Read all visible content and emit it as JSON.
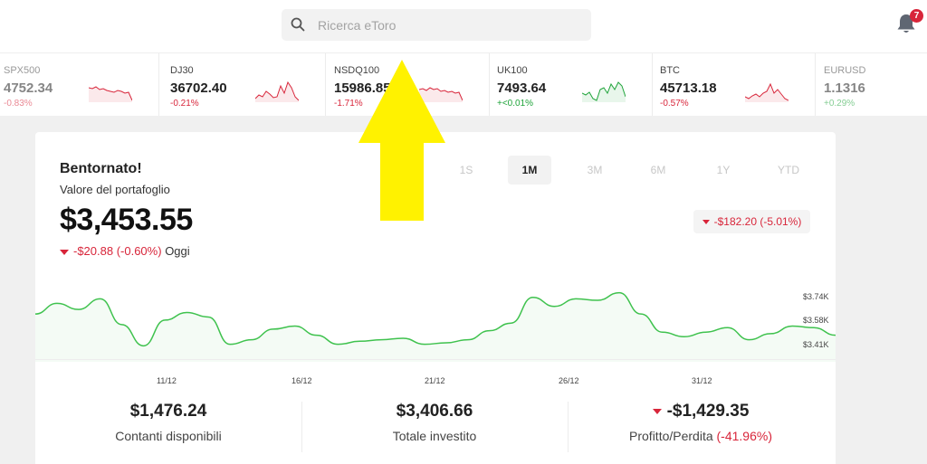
{
  "search": {
    "placeholder": "Ricerca eToro"
  },
  "notifications": {
    "count": "7"
  },
  "ticker": [
    {
      "symbol": "SPX500",
      "price": "4752.34",
      "change": "-0.83%",
      "dir": "neg",
      "spark": [
        8,
        9,
        7,
        10,
        9,
        11,
        12,
        13,
        11,
        12,
        14,
        13,
        22
      ]
    },
    {
      "symbol": "DJ30",
      "price": "36702.40",
      "change": "-0.21%",
      "dir": "neg",
      "spark": [
        20,
        16,
        18,
        12,
        15,
        19,
        18,
        6,
        14,
        2,
        8,
        18,
        22
      ]
    },
    {
      "symbol": "NSDQ100",
      "price": "15986.85",
      "change": "-1.71%",
      "dir": "neg",
      "spark": [
        10,
        9,
        11,
        8,
        10,
        9,
        12,
        11,
        13,
        12,
        14,
        13,
        22
      ]
    },
    {
      "symbol": "UK100",
      "price": "7493.64",
      "change": "+<0.01%",
      "dir": "pos",
      "spark": [
        14,
        16,
        13,
        20,
        22,
        10,
        8,
        14,
        4,
        10,
        2,
        6,
        18
      ]
    },
    {
      "symbol": "BTC",
      "price": "45713.18",
      "change": "-0.57%",
      "dir": "neg",
      "spark": [
        18,
        20,
        17,
        15,
        18,
        14,
        12,
        4,
        14,
        10,
        15,
        20,
        22
      ]
    },
    {
      "symbol": "EURUSD",
      "price": "1.1316",
      "change": "+0.29%",
      "dir": "pos",
      "spark": []
    }
  ],
  "card": {
    "welcome": "Bentornato!",
    "portfolio_label": "Valore del portafoglio",
    "portfolio_value": "$3,453.55",
    "today_change": "-$20.88 (-0.60%)",
    "today_label": "Oggi",
    "period_change": "-$182.20 (-5.01%)",
    "ranges": [
      "1S",
      "1M",
      "3M",
      "6M",
      "1Y",
      "YTD"
    ],
    "active_range": "1M",
    "y_labels": [
      "$3.74K",
      "$3.58K",
      "$3.41K"
    ],
    "x_labels": [
      "11/12",
      "16/12",
      "21/12",
      "26/12",
      "31/12"
    ],
    "stats": [
      {
        "value": "$1,476.24",
        "label": "Contanti disponibili",
        "dir": ""
      },
      {
        "value": "$3,406.66",
        "label": "Totale investito",
        "dir": ""
      },
      {
        "value": "-$1,429.35",
        "label": "Profitto/Perdita",
        "label_extra": "(-41.96%)",
        "dir": "neg"
      }
    ]
  },
  "colors": {
    "negative": "#d8253a",
    "positive": "#1fa43a",
    "chart_line": "#3fc24e",
    "arrow": "#fff200"
  },
  "chart_data": {
    "type": "area",
    "x": [
      "11/12",
      "16/12",
      "21/12",
      "26/12",
      "31/12"
    ],
    "y_range": [
      3410,
      3740
    ],
    "series": [
      {
        "values": [
          3620,
          3690,
          3650,
          3720,
          3550,
          3410,
          3580,
          3630,
          3600,
          3420,
          3450,
          3520,
          3540,
          3480,
          3420,
          3440,
          3450,
          3460,
          3420,
          3430,
          3450,
          3510,
          3560,
          3730,
          3670,
          3720,
          3710,
          3760,
          3620,
          3500,
          3470,
          3500,
          3530,
          3450,
          3490,
          3540,
          3530,
          3480
        ]
      }
    ]
  }
}
